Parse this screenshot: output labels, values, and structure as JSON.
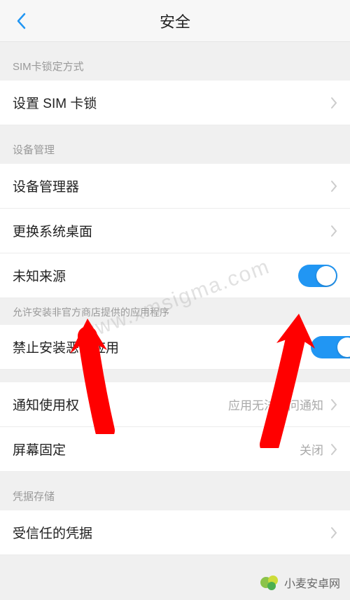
{
  "header": {
    "title": "安全"
  },
  "sections": {
    "sim": {
      "header": "SIM卡锁定方式",
      "set_sim_lock": "设置 SIM 卡锁"
    },
    "device": {
      "header": "设备管理",
      "device_admin": "设备管理器",
      "change_launcher": "更换系统桌面",
      "unknown_sources": "未知来源",
      "unknown_sources_hint": "允许安装非官方商店提供的应用程序",
      "block_malicious": "禁止安装恶意应用",
      "notification_access": "通知使用权",
      "notification_access_value": "应用无法访问通知",
      "screen_pinning": "屏幕固定",
      "screen_pinning_value": "关闭"
    },
    "credentials": {
      "header": "凭据存储",
      "trusted_credentials": "受信任的凭据"
    }
  },
  "toggles": {
    "unknown_sources_on": true,
    "block_malicious_on": true
  },
  "colors": {
    "accent": "#2196f3",
    "arrow": "#ff0000"
  },
  "watermark": {
    "center": "www.xmsigma.com",
    "bottom": "小麦安卓网"
  }
}
